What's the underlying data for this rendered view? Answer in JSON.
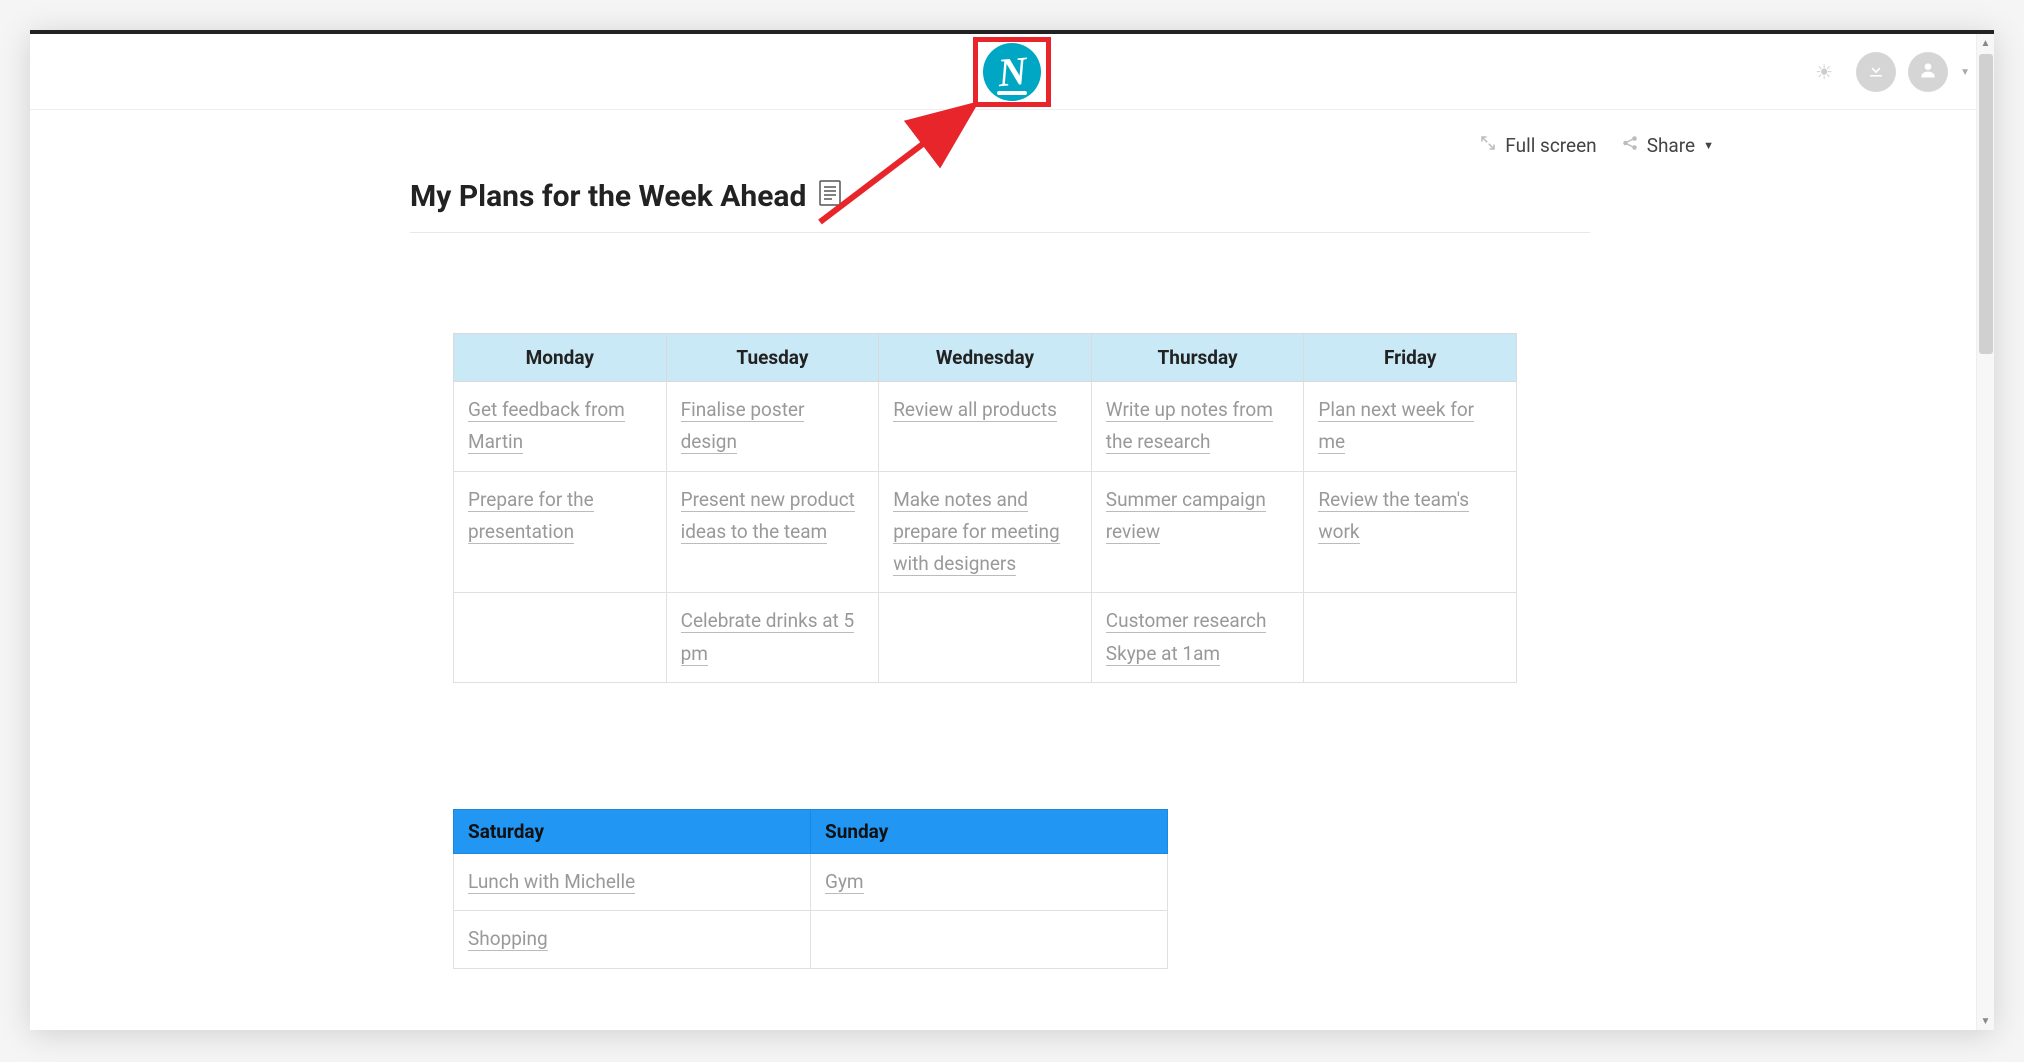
{
  "header": {
    "logo_letter": "N"
  },
  "toolbar": {
    "fullscreen_label": "Full screen",
    "share_label": "Share"
  },
  "page": {
    "title": "My Plans for the Week Ahead",
    "title_icon": "📄"
  },
  "weekdays": {
    "headers": [
      "Monday",
      "Tuesday",
      "Wednesday",
      "Thursday",
      "Friday"
    ],
    "rows": [
      [
        "Get feedback from Martin",
        "Finalise poster design",
        "Review all products",
        "Write up notes from the research",
        "Plan next week for me"
      ],
      [
        "Prepare for the presentation",
        "Present new product ideas to the team",
        "Make notes and prepare for meeting with designers",
        "Summer campaign review",
        "Review the team's work"
      ],
      [
        "",
        "Celebrate drinks at 5 pm",
        "",
        "Customer research Skype at 1am",
        ""
      ]
    ]
  },
  "weekend": {
    "headers": [
      "Saturday",
      "Sunday"
    ],
    "rows": [
      [
        "Lunch with Michelle",
        "Gym"
      ],
      [
        "Shopping",
        ""
      ]
    ]
  }
}
